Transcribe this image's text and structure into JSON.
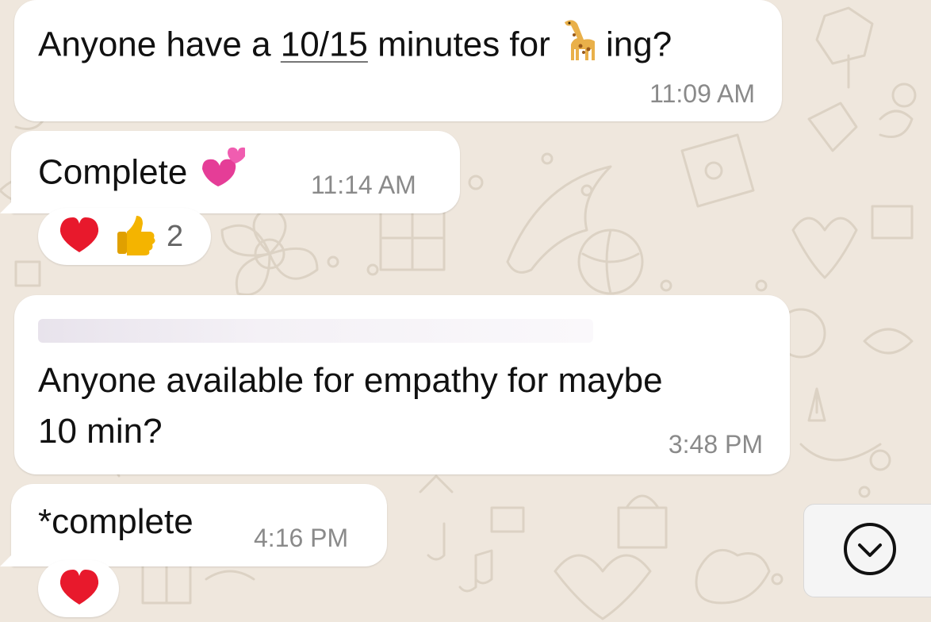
{
  "messages": [
    {
      "text_before_link": "Anyone have a ",
      "link": "10/15",
      "text_after_link": " minutes for ",
      "emoji": "giraffe",
      "text_suffix": "ing?",
      "time": "11:09 AM"
    },
    {
      "text": "Complete",
      "emoji": "two-hearts",
      "time": "11:14 AM",
      "reactions": {
        "emojis": [
          "red-heart",
          "thumbs-up"
        ],
        "count": "2"
      }
    },
    {
      "text": "Anyone available for empathy for maybe",
      "text_line2": "10 min?",
      "time": "3:48 PM"
    },
    {
      "text": "*complete",
      "time": "4:16 PM",
      "reactions": {
        "emojis": [
          "red-heart"
        ]
      }
    }
  ],
  "colors": {
    "wallpaper": "#efe7dd",
    "bubble": "#ffffff",
    "timestamp": "#8a8a8a",
    "heart": "#e8192c",
    "thumb": "#f4b400"
  },
  "icons": [
    "scroll-down-chevron-icon"
  ]
}
